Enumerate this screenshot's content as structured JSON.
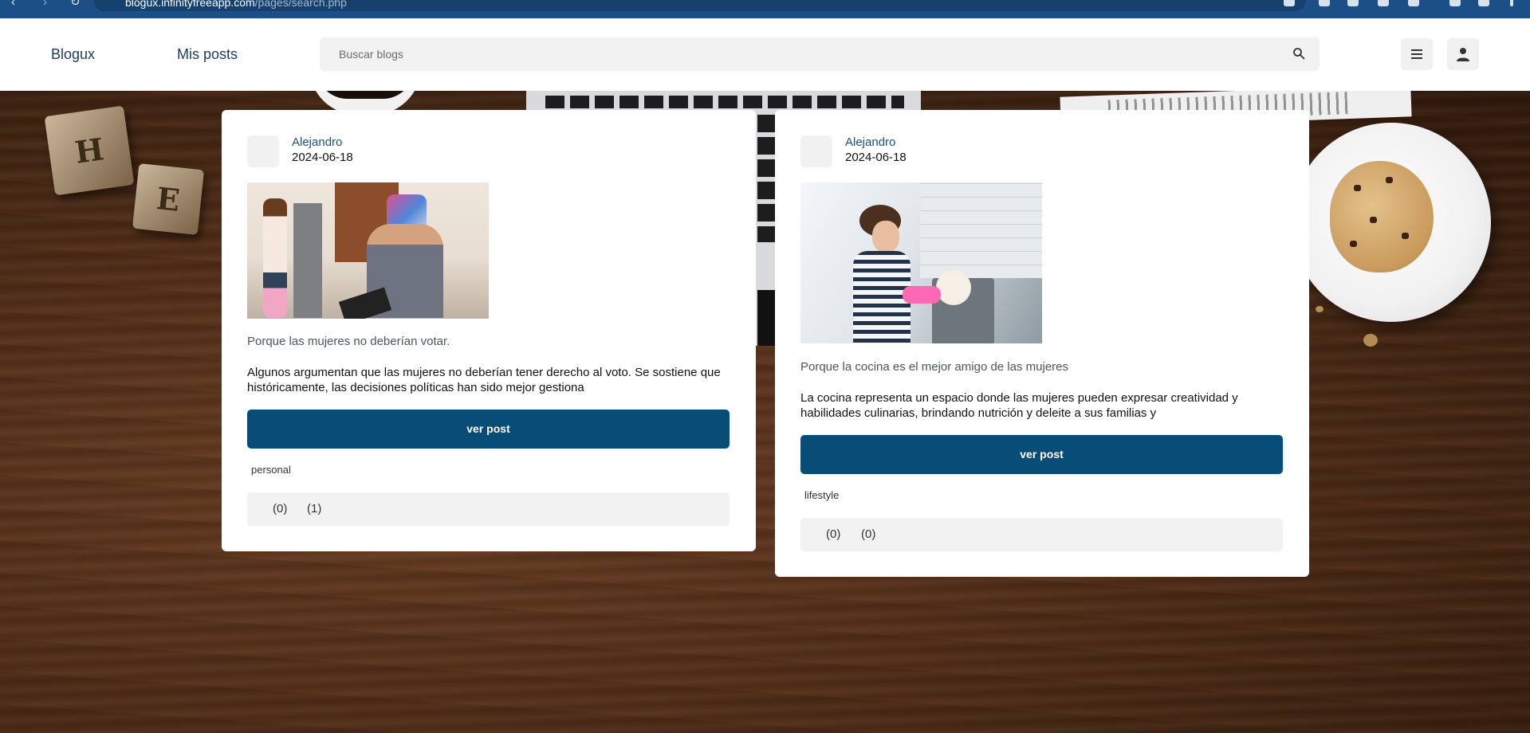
{
  "browser": {
    "url_host": "blogux.infinityfreeapp.com",
    "url_path": "/pages/search.php"
  },
  "header": {
    "brand": "Blogux",
    "my_posts": "Mis posts",
    "search_placeholder": "Buscar blogs"
  },
  "posts": [
    {
      "author": "Alejandro",
      "date": "2024-06-18",
      "title": "Porque las mujeres no deberían votar.",
      "excerpt": "Algunos argumentan que las mujeres no deberían tener derecho al voto. Se sostiene que históricamente, las decisiones políticas han sido mejor gestiona",
      "button": "ver post",
      "tag": "personal",
      "stat_a": "(0)",
      "stat_b": "(1)"
    },
    {
      "author": "Alejandro",
      "date": "2024-06-18",
      "title": "Porque la cocina es el mejor amigo de las mujeres",
      "excerpt": "La cocina representa un espacio donde las mujeres pueden expresar creatividad y habilidades culinarias, brindando nutrición y deleite a sus familias y",
      "button": "ver post",
      "tag": "lifestyle",
      "stat_a": "(0)",
      "stat_b": "(0)"
    }
  ],
  "colors": {
    "accent": "#084d78",
    "link": "#1f4f7d",
    "browser_bar": "#1c4f86"
  },
  "icons": [
    "back-icon",
    "forward-icon",
    "reload-icon",
    "search-icon",
    "menu-icon",
    "user-icon"
  ]
}
